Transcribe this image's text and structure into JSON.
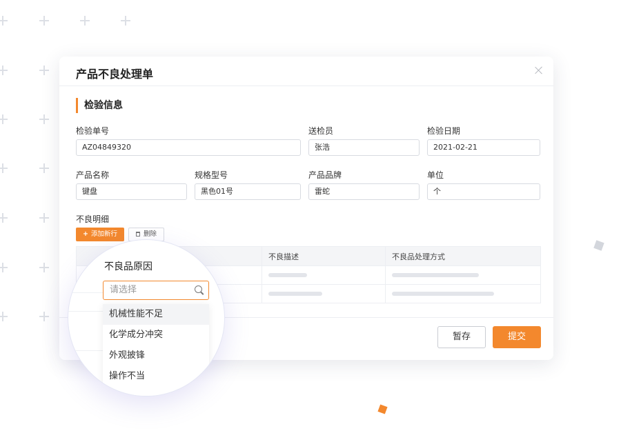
{
  "dialog": {
    "title": "产品不良处理单",
    "section_title": "检验信息",
    "fields": {
      "inspection_no": {
        "label": "检验单号",
        "value": "AZ04849320"
      },
      "inspector": {
        "label": "送检员",
        "value": "张浩"
      },
      "inspection_date": {
        "label": "检验日期",
        "value": "2021-02-21"
      },
      "product_name": {
        "label": "产品名称",
        "value": "键盘"
      },
      "spec_model": {
        "label": "规格型号",
        "value": "黑色01号"
      },
      "brand": {
        "label": "产品品牌",
        "value": "雷蛇"
      },
      "unit": {
        "label": "单位",
        "value": "个"
      }
    },
    "defect_detail_label": "不良明细",
    "add_row_label": "添加新行",
    "delete_label": "删除",
    "table": {
      "headers": [
        "不良品原因",
        "不良描述",
        "不良品处理方式"
      ]
    },
    "save_label": "暂存",
    "submit_label": "提交"
  },
  "magnifier": {
    "column_title": "不良品原因",
    "select_placeholder": "请选择",
    "options": [
      "机械性能不足",
      "化学成分冲突",
      "外观披锋",
      "操作不当"
    ]
  },
  "colors": {
    "accent": "#f3882d",
    "border": "#d7dae0",
    "table_header_bg": "#f4f5f7",
    "skeleton": "#e3e5ea"
  },
  "icons": [
    "close-icon",
    "plus-icon",
    "trash-icon",
    "search-icon"
  ]
}
